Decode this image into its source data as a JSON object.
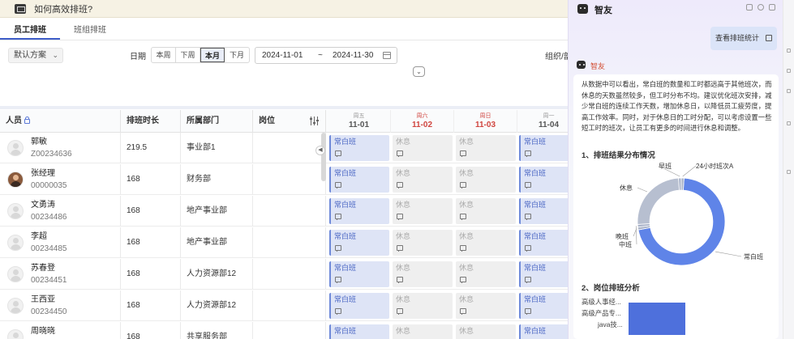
{
  "window": {
    "title": "如何高效排班?"
  },
  "tabs": [
    {
      "label": "员工排班",
      "active": true
    },
    {
      "label": "班组排班",
      "active": false
    }
  ],
  "filters": {
    "plan": "默认方案",
    "date_label": "日期",
    "range_buttons": [
      "本周",
      "下周",
      "本月",
      "下月"
    ],
    "range_active": "本月",
    "date_start": "2024-11-01",
    "date_sep": "~",
    "date_end": "2024-11-30",
    "org_label": "组织/部"
  },
  "table": {
    "columns": {
      "person": "人员",
      "hours": "排班时长",
      "dept": "所属部门",
      "position": "岗位"
    },
    "days": [
      {
        "weekday": "周五",
        "date": "11-01",
        "weekend": false
      },
      {
        "weekday": "周六",
        "date": "11-02",
        "weekend": true
      },
      {
        "weekday": "周日",
        "date": "11-03",
        "weekend": true
      },
      {
        "weekday": "周一",
        "date": "11-04",
        "weekend": false
      }
    ],
    "rows": [
      {
        "name": "郭敏",
        "id": "Z00234636",
        "hours": "219.5",
        "dept": "事业部1",
        "photo": false,
        "shifts": [
          "常白班",
          "休息",
          "休息",
          "常白班"
        ]
      },
      {
        "name": "张经理",
        "id": "00000035",
        "hours": "168",
        "dept": "财务部",
        "photo": true,
        "shifts": [
          "常白班",
          "休息",
          "休息",
          "常白班"
        ]
      },
      {
        "name": "文勇涛",
        "id": "00234486",
        "hours": "168",
        "dept": "地产事业部",
        "photo": false,
        "shifts": [
          "常白班",
          "休息",
          "休息",
          "常白班"
        ]
      },
      {
        "name": "李超",
        "id": "00234485",
        "hours": "168",
        "dept": "地产事业部",
        "photo": false,
        "shifts": [
          "常白班",
          "休息",
          "休息",
          "常白班"
        ]
      },
      {
        "name": "苏春登",
        "id": "00234451",
        "hours": "168",
        "dept": "人力资源部12",
        "photo": false,
        "shifts": [
          "常白班",
          "休息",
          "休息",
          "常白班"
        ]
      },
      {
        "name": "王西亚",
        "id": "00234450",
        "hours": "168",
        "dept": "人力资源部12",
        "photo": false,
        "shifts": [
          "常白班",
          "休息",
          "休息",
          "常白班"
        ]
      },
      {
        "name": "周晓晓",
        "id": "",
        "hours": "168",
        "dept": "共享服务部",
        "photo": false,
        "shifts": [
          "常白班",
          "休息",
          "休息",
          "常白班"
        ]
      }
    ],
    "rest_label": "休息"
  },
  "assistant": {
    "title": "智友",
    "stats_button": "查看排班统计",
    "sender": "智友",
    "message": "从数据中可以看出，常白班的数量和工时都远高于其他班次，而休息的天数虽然较多，但工时分布不均。建议优化班次安排，减少常白班的连续工作天数，增加休息日，以降低员工疲劳度，提高工作效率。同时，对于休息日的工时分配，可以考虑设置一些短工时的班次，让员工有更多的时间进行休息和调整。",
    "section1": "1、排班结果分布情况",
    "section2": "2、岗位排班分析",
    "positions": [
      "高级人事经...",
      "高级产品专...",
      "java技..."
    ]
  },
  "chart_data": {
    "type": "pie",
    "title": "",
    "categories": [
      "常白班",
      "晚班",
      "中班",
      "休息",
      "早班",
      "24小时班次A"
    ],
    "values": [
      71,
      1,
      1,
      25,
      1,
      1
    ],
    "colors": [
      "#5f84e8",
      "#a9b3c9",
      "#a9b3c9",
      "#b7bfd0",
      "#a9b3c9",
      "#a9b3c9"
    ],
    "inner_radius_ratio": 0.72
  }
}
